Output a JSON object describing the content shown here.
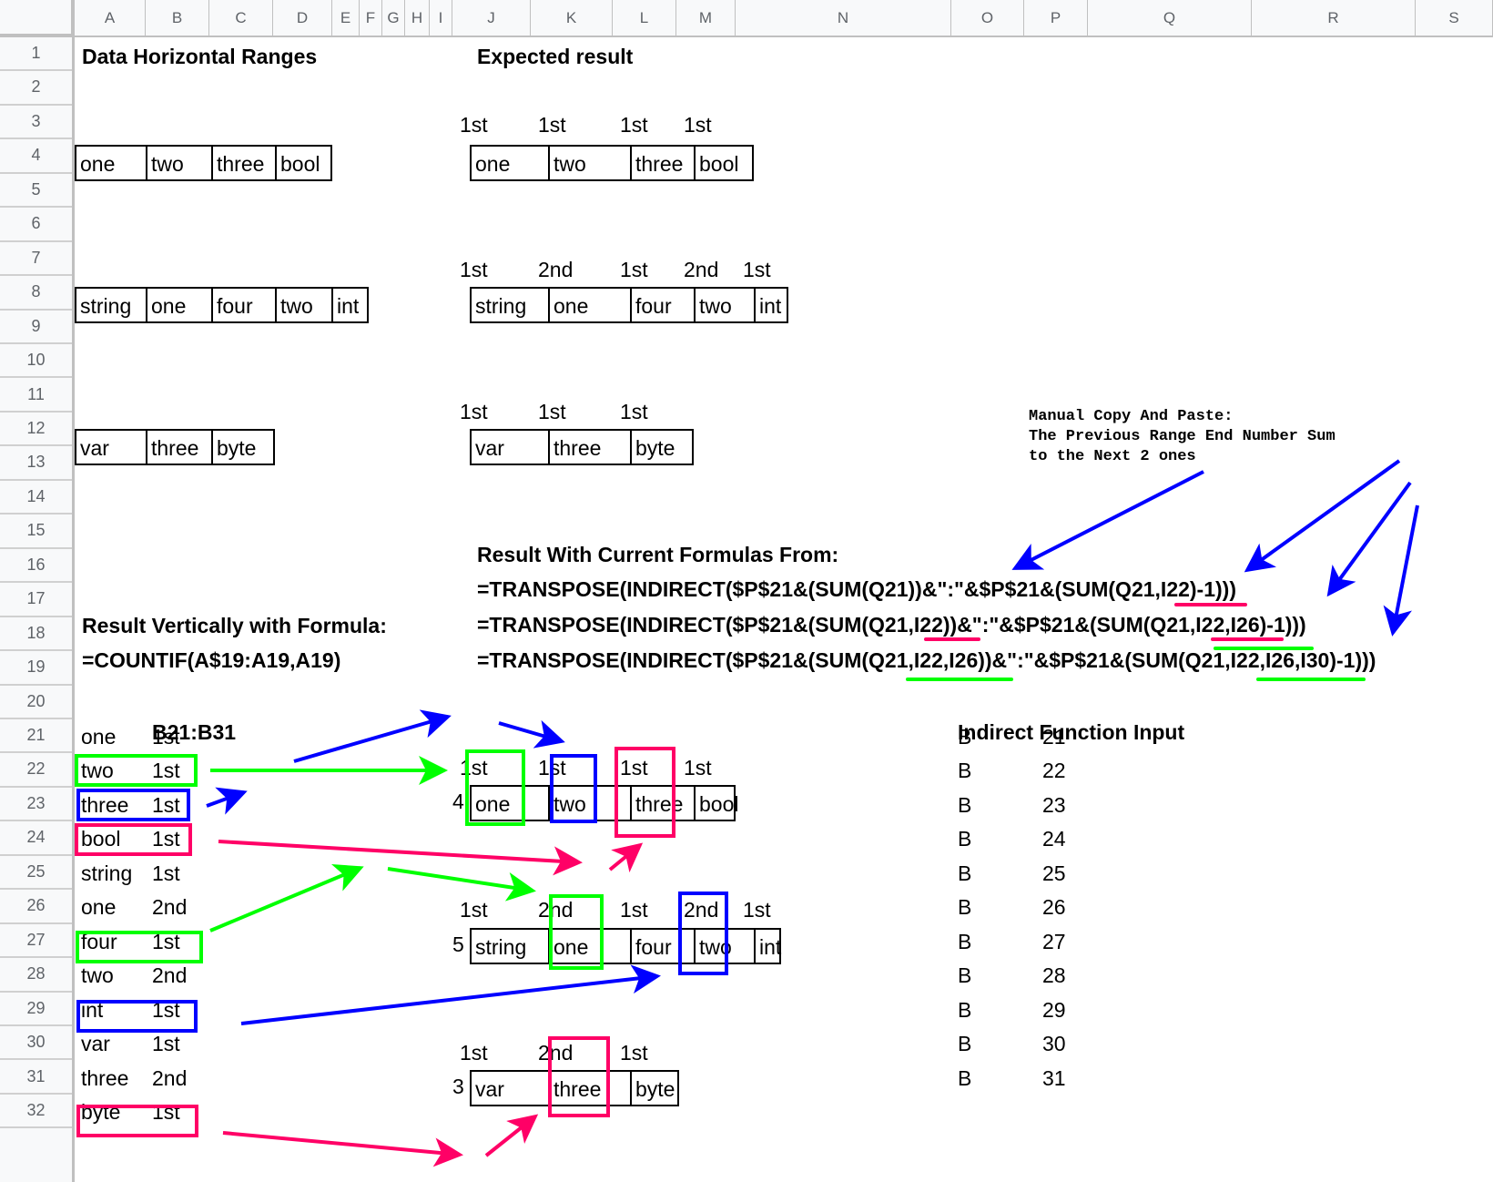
{
  "columns": [
    "A",
    "B",
    "C",
    "D",
    "E",
    "F",
    "G",
    "H",
    "I",
    "J",
    "K",
    "L",
    "M",
    "N",
    "O",
    "P",
    "Q",
    "R",
    "S",
    ""
  ],
  "rows": [
    "1",
    "2",
    "3",
    "4",
    "5",
    "6",
    "7",
    "8",
    "9",
    "10",
    "11",
    "12",
    "13",
    "14",
    "15",
    "16",
    "17",
    "18",
    "19",
    "20",
    "21",
    "22",
    "23",
    "24",
    "25",
    "26",
    "27",
    "28",
    "29",
    "30",
    "31",
    "32"
  ],
  "colors": {
    "green": "#00ff00",
    "blue": "#0000ff",
    "pink": "#ff0066",
    "header_bg": "#f8f9fa",
    "gridline": "#c0c0c0"
  },
  "data_ranges": {
    "title": "Data Horizontal Ranges",
    "ranges": [
      [
        "one",
        "two",
        "three",
        "bool"
      ],
      [
        "string",
        "one",
        "four",
        "two",
        "int"
      ],
      [
        "var",
        "three",
        "byte"
      ]
    ]
  },
  "expected": {
    "title": "Expected result",
    "groups": [
      {
        "ranks": [
          "1st",
          "1st",
          "1st",
          "1st"
        ],
        "values": [
          "one",
          "two",
          "three",
          "bool"
        ]
      },
      {
        "ranks": [
          "1st",
          "2nd",
          "1st",
          "2nd",
          "1st"
        ],
        "values": [
          "string",
          "one",
          "four",
          "two",
          "int"
        ]
      },
      {
        "ranks": [
          "1st",
          "1st",
          "1st"
        ],
        "values": [
          "var",
          "three",
          "byte"
        ]
      }
    ]
  },
  "note": {
    "lines": [
      "Manual Copy And Paste:",
      "The Previous Range End Number Sum",
      "to the Next 2 ones"
    ]
  },
  "current_formulas": {
    "title": "Result With Current Formulas From:",
    "formulas": [
      "=TRANSPOSE(INDIRECT($P$21&(SUM(Q21))&\":\"&$P$21&(SUM(Q21,I22)-1)))",
      "=TRANSPOSE(INDIRECT($P$21&(SUM(Q21,I22))&\":\"&$P$21&(SUM(Q21,I22,I26)-1)))",
      "=TRANSPOSE(INDIRECT($P$21&(SUM(Q21,I22,I26))&\":\"&$P$21&(SUM(Q21,I22,I26,I30)-1)))"
    ]
  },
  "vertical": {
    "title": "Result Vertically with Formula:",
    "formula": "=COUNTIF(A$19:A19,A19)",
    "range_label": "B21:B31",
    "items": [
      {
        "value": "one",
        "rank": "1st"
      },
      {
        "value": "two",
        "rank": "1st"
      },
      {
        "value": "three",
        "rank": "1st"
      },
      {
        "value": "bool",
        "rank": "1st"
      },
      {
        "value": "string",
        "rank": "1st"
      },
      {
        "value": "one",
        "rank": "2nd"
      },
      {
        "value": "four",
        "rank": "1st"
      },
      {
        "value": "two",
        "rank": "2nd"
      },
      {
        "value": "int",
        "rank": "1st"
      },
      {
        "value": "var",
        "rank": "1st"
      },
      {
        "value": "three",
        "rank": "2nd"
      },
      {
        "value": "byte",
        "rank": "1st"
      }
    ]
  },
  "current_results": [
    {
      "count": "4",
      "ranks": [
        "1st",
        "1st",
        "1st",
        "1st"
      ],
      "values": [
        "one",
        "two",
        "three",
        "bool"
      ]
    },
    {
      "count": "5",
      "ranks": [
        "1st",
        "2nd",
        "1st",
        "2nd",
        "1st"
      ],
      "values": [
        "string",
        "one",
        "four",
        "two",
        "int"
      ]
    },
    {
      "count": "3",
      "ranks": [
        "1st",
        "2nd",
        "1st"
      ],
      "values": [
        "var",
        "three",
        "byte"
      ]
    }
  ],
  "indirect_input": {
    "title": "Indirect Function Input",
    "rows": [
      {
        "col": "B",
        "row": "21"
      },
      {
        "col": "B",
        "row": "22"
      },
      {
        "col": "B",
        "row": "23"
      },
      {
        "col": "B",
        "row": "24"
      },
      {
        "col": "B",
        "row": "25"
      },
      {
        "col": "B",
        "row": "26"
      },
      {
        "col": "B",
        "row": "27"
      },
      {
        "col": "B",
        "row": "28"
      },
      {
        "col": "B",
        "row": "29"
      },
      {
        "col": "B",
        "row": "30"
      },
      {
        "col": "B",
        "row": "31"
      }
    ]
  }
}
